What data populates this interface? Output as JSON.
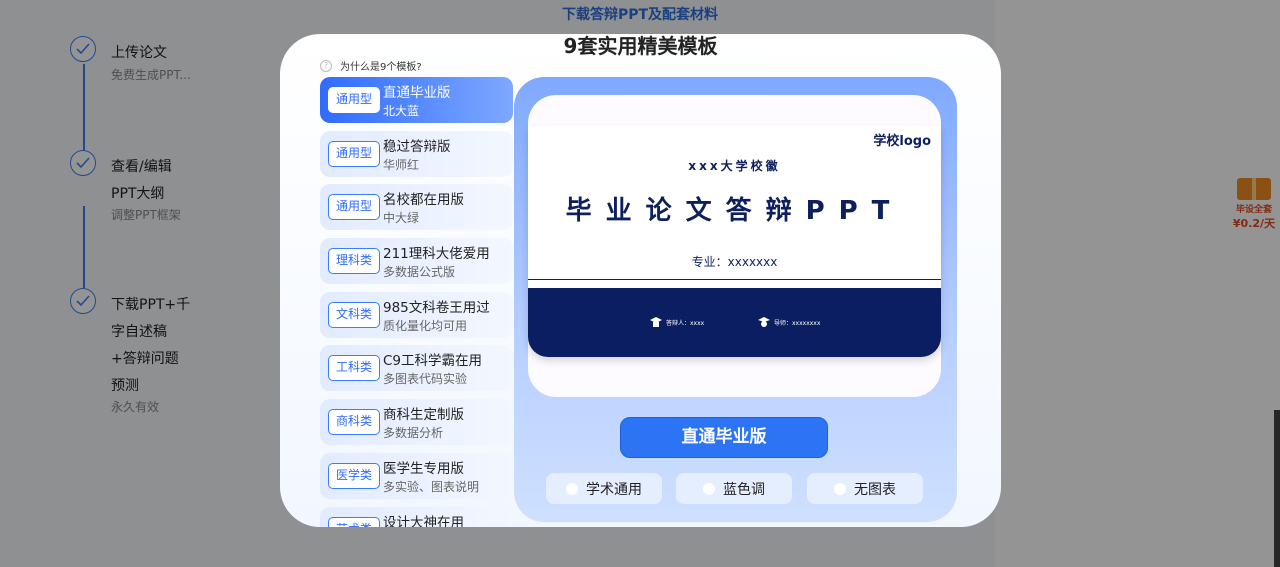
{
  "background": {
    "top_link": "下载答辩PPT及配套材料",
    "steps": [
      {
        "title_lines": [
          "上传论文"
        ],
        "sub": "免费生成PPT..."
      },
      {
        "title_lines": [
          "查看/编辑",
          "PPT大纲"
        ],
        "sub": "调整PPT框架"
      },
      {
        "title_lines": [
          "下载PPT+千",
          "字自述稿",
          "+答辩问题",
          "预测"
        ],
        "sub": "永久有效"
      }
    ],
    "gift": {
      "line1": "毕设全套",
      "line2": "¥0.2/天"
    }
  },
  "modal": {
    "title": "9套实用精美模板",
    "why_label": "为什么是9个模板?",
    "why_icon": "?",
    "templates": [
      {
        "tag": "通用型",
        "name": "直通毕业版",
        "sub": "北大蓝",
        "active": true
      },
      {
        "tag": "通用型",
        "name": "稳过答辩版",
        "sub": "华师红",
        "active": false
      },
      {
        "tag": "通用型",
        "name": "名校都在用版",
        "sub": "中大绿",
        "active": false
      },
      {
        "tag": "理科类",
        "name": "211理科大佬爱用",
        "sub": "多数据公式版",
        "active": false
      },
      {
        "tag": "文科类",
        "name": "985文科卷王用过",
        "sub": "质化量化均可用",
        "active": false
      },
      {
        "tag": "工科类",
        "name": "C9工科学霸在用",
        "sub": "多图表代码实验",
        "active": false
      },
      {
        "tag": "商科类",
        "name": "商科生定制版",
        "sub": "多数据分析",
        "active": false
      },
      {
        "tag": "医学类",
        "name": "医学生专用版",
        "sub": "多实验、图表说明",
        "active": false
      },
      {
        "tag": "艺术类",
        "name": "设计大神在用",
        "sub": "",
        "active": false
      }
    ],
    "preview": {
      "logo": "学校logo",
      "emblem": "xxx大学校徽",
      "title": "毕业论文答辩PPT",
      "major": "专业：xxxxxxx",
      "presenter": "答辩人：xxxx",
      "advisor": "导师：xxxxxxxx"
    },
    "selected_button": "直通毕业版",
    "chips": [
      "学术通用",
      "蓝色调",
      "无图表"
    ]
  }
}
